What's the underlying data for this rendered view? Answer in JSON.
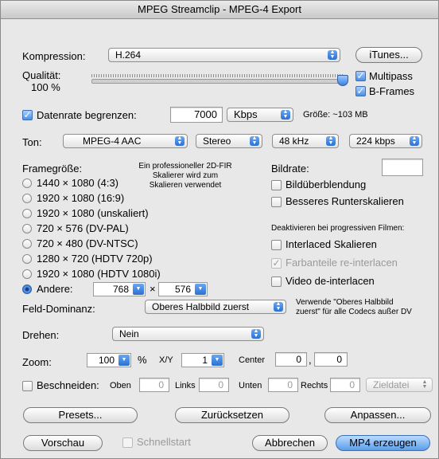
{
  "window": {
    "title": "MPEG Streamclip - MPEG-4 Export"
  },
  "compression": {
    "label": "Kompression:",
    "value": "H.264",
    "itunes_button": "iTunes..."
  },
  "quality": {
    "label": "Qualität:",
    "value_text": "100 %",
    "level": 1.0
  },
  "multipass": {
    "label": "Multipass",
    "checked": true
  },
  "bframes": {
    "label": "B-Frames",
    "checked": true
  },
  "datarate": {
    "label": "Datenrate begrenzen:",
    "value": "7000",
    "unit": "Kbps",
    "size_note": "Größe: ~103 MB"
  },
  "audio": {
    "label": "Ton:",
    "codec": "MPEG-4 AAC",
    "channels": "Stereo",
    "rate": "48 kHz",
    "bitrate": "224 kbps"
  },
  "framesize": {
    "label": "Framegröße:",
    "scaler_note": "Ein professioneller 2D-FIR\nSkalierer wird zum\nSkalieren verwendet",
    "options": [
      "1440 × 1080  (4:3)",
      "1920 × 1080  (16:9)",
      "1920 × 1080  (unskaliert)",
      "720 × 576  (DV-PAL)",
      "720 × 480  (DV-NTSC)",
      "1280 × 720  (HDTV 720p)",
      "1920 × 1080  (HDTV 1080i)"
    ],
    "other_label": "Andere:",
    "other_width": "768",
    "times": "×",
    "other_height": "576"
  },
  "framerate": {
    "label": "Bildrate:",
    "value": ""
  },
  "blend": {
    "label": "Bildüberblendung"
  },
  "downscale": {
    "label": "Besseres Runterskalieren"
  },
  "progressive": {
    "label": "Deaktivieren bei progressiven Filmen:",
    "interlaced_scaling": "Interlaced Skalieren",
    "chroma_reinterlace": "Farbanteile re-interlacen",
    "deinterlace": "Video de-interlacen"
  },
  "field_dominance": {
    "label": "Feld-Dominanz:",
    "value": "Oberes Halbbild zuerst",
    "note": "Verwende \"Oberes Halbbild\nzuerst\" für alle Codecs außer DV"
  },
  "rotate": {
    "label": "Drehen:",
    "value": "Nein"
  },
  "zoom": {
    "label": "Zoom:",
    "value": "100",
    "percent": "%",
    "xy_label": "X/Y",
    "xy_value": "1",
    "center_label": "Center",
    "center_x": "0",
    "center_sep": ",",
    "center_y": "0"
  },
  "crop": {
    "label": "Beschneiden:",
    "top_label": "Oben",
    "top": "0",
    "left_label": "Links",
    "left": "0",
    "bottom_label": "Unten",
    "bottom": "0",
    "right_label": "Rechts",
    "right": "0",
    "target": "Zieldatei"
  },
  "buttons": {
    "presets": "Presets...",
    "reset": "Zurücksetzen",
    "adjust": "Anpassen...",
    "preview": "Vorschau",
    "quickstart": "Schnellstart",
    "cancel": "Abbrechen",
    "create": "MP4 erzeugen"
  },
  "icons": {
    "popup_arrows": "updown-arrows-icon",
    "combo_arrow": "chevron-down-icon",
    "check": "check-icon"
  },
  "colors": {
    "accent": "#3d7ee0",
    "window_bg": "#e8e8e8"
  }
}
